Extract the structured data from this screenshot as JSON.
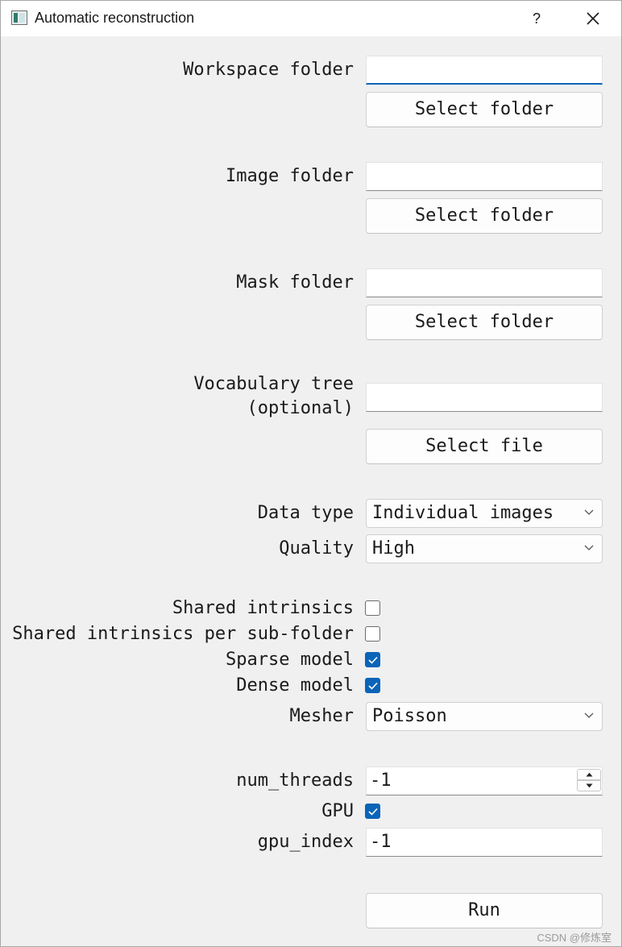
{
  "window": {
    "title": "Automatic reconstruction",
    "help_label": "?"
  },
  "workspace": {
    "label": "Workspace folder",
    "value": "",
    "button": "Select folder"
  },
  "image": {
    "label": "Image folder",
    "value": "",
    "button": "Select folder"
  },
  "mask": {
    "label": "Mask folder",
    "value": "",
    "button": "Select folder"
  },
  "vocab": {
    "label_line1": "Vocabulary tree",
    "label_line2": "(optional)",
    "value": "",
    "button": "Select file"
  },
  "data_type": {
    "label": "Data type",
    "selected": "Individual images"
  },
  "quality": {
    "label": "Quality",
    "selected": "High"
  },
  "options": {
    "shared_intrinsics": {
      "label": "Shared intrinsics",
      "checked": false
    },
    "shared_per_subfolder": {
      "label": "Shared intrinsics per sub-folder",
      "checked": false
    },
    "sparse_model": {
      "label": "Sparse model",
      "checked": true
    },
    "dense_model": {
      "label": "Dense model",
      "checked": true
    }
  },
  "mesher": {
    "label": "Mesher",
    "selected": "Poisson"
  },
  "num_threads": {
    "label": "num_threads",
    "value": "-1"
  },
  "gpu": {
    "label": "GPU",
    "checked": true
  },
  "gpu_index": {
    "label": "gpu_index",
    "value": "-1"
  },
  "run": {
    "label": "Run"
  },
  "watermark": "CSDN @修炼室",
  "colors": {
    "accent": "#0a64b8",
    "background": "#f0f0f0"
  }
}
